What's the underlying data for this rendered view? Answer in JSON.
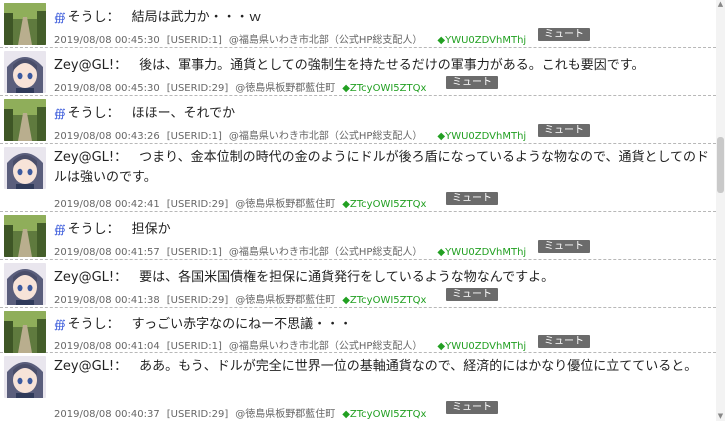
{
  "posts": [
    {
      "user": "そうし：",
      "text": "結局は武力か・・・ｗ",
      "datetime": "2019/08/08 00:45:30",
      "userid": "[USERID:1]",
      "location": "@福島県いわき市北部（公式HP総支配人）",
      "trip": "◆YWU0ZDVhMThj",
      "mute": "ミュート",
      "avatar": "road",
      "mark": "∰"
    },
    {
      "user": "Zey@GL!：",
      "text": "後は、軍事力。通貨としての強制生を持たせるだけの軍事力がある。これも要因です。",
      "datetime": "2019/08/08 00:45:30",
      "userid": "[USERID:29]",
      "location": "@徳島県板野郡藍住町",
      "trip": "◆ZTcyOWI5ZTQx",
      "mute": "ミュート",
      "avatar": "girl"
    },
    {
      "user": "そうし：",
      "text": "ほほー、それでか",
      "datetime": "2019/08/08 00:43:26",
      "userid": "[USERID:1]",
      "location": "@福島県いわき市北部（公式HP総支配人）",
      "trip": "◆YWU0ZDVhMThj",
      "mute": "ミュート",
      "avatar": "road",
      "mark": "∰"
    },
    {
      "user": "Zey@GL!：",
      "text": "つまり、金本位制の時代の金のようにドルが後ろ盾になっているような物なので、通貨としてのドルは強いのです。",
      "datetime": "2019/08/08 00:42:41",
      "userid": "[USERID:29]",
      "location": "@徳島県板野郡藍住町",
      "trip": "◆ZTcyOWI5ZTQx",
      "mute": "ミュート",
      "avatar": "girl"
    },
    {
      "user": "そうし：",
      "text": "担保か",
      "datetime": "2019/08/08 00:41:57",
      "userid": "[USERID:1]",
      "location": "@福島県いわき市北部（公式HP総支配人）",
      "trip": "◆YWU0ZDVhMThj",
      "mute": "ミュート",
      "avatar": "road",
      "mark": "∰"
    },
    {
      "user": "Zey@GL!：",
      "text": "要は、各国米国債権を担保に通貨発行をしているような物なんですよ。",
      "datetime": "2019/08/08 00:41:38",
      "userid": "[USERID:29]",
      "location": "@徳島県板野郡藍住町",
      "trip": "◆ZTcyOWI5ZTQx",
      "mute": "ミュート",
      "avatar": "girl"
    },
    {
      "user": "そうし：",
      "text": "すっごい赤字なのにねー不思議・・・",
      "datetime": "2019/08/08 00:41:04",
      "userid": "[USERID:1]",
      "location": "@福島県いわき市北部（公式HP総支配人）",
      "trip": "◆YWU0ZDVhMThj",
      "mute": "ミュート",
      "avatar": "road",
      "mark": "∰"
    },
    {
      "user": "Zey@GL!：",
      "text": "ああ。もう、ドルが完全に世界一位の基軸通貨なので、経済的にはかなり優位に立てていると。",
      "datetime": "2019/08/08 00:40:37",
      "userid": "[USERID:29]",
      "location": "@徳島県板野郡藍住町",
      "trip": "◆ZTcyOWI5ZTQx",
      "mute": "ミュート",
      "avatar": "girl"
    }
  ]
}
